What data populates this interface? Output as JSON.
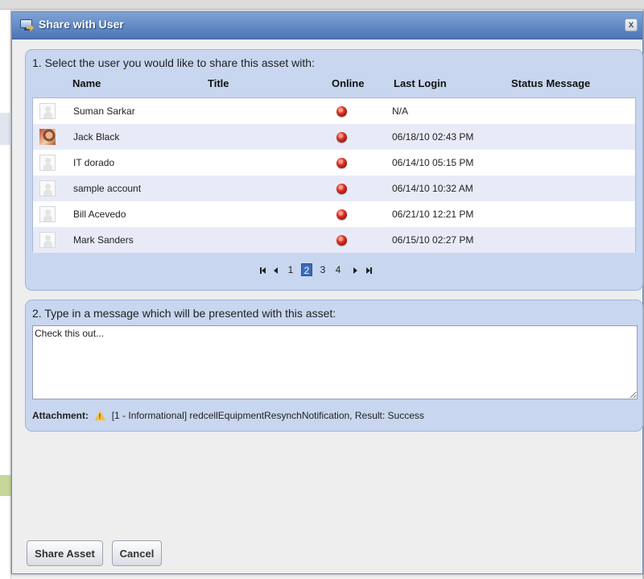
{
  "dialog": {
    "title": "Share with User",
    "close_label": "x"
  },
  "step1": {
    "title": "1. Select the user you would like to share this asset with:",
    "columns": {
      "name": "Name",
      "title": "Title",
      "online": "Online",
      "last_login": "Last Login",
      "status_message": "Status Message"
    },
    "rows": [
      {
        "name": "Suman Sarkar",
        "title": "",
        "online": "offline",
        "last_login": "N/A",
        "status_message": "",
        "avatar": "default"
      },
      {
        "name": "Jack Black",
        "title": "",
        "online": "offline",
        "last_login": "06/18/10 02:43 PM",
        "status_message": "",
        "avatar": "photo"
      },
      {
        "name": "IT dorado",
        "title": "",
        "online": "offline",
        "last_login": "06/14/10 05:15 PM",
        "status_message": "",
        "avatar": "default"
      },
      {
        "name": "sample account",
        "title": "",
        "online": "offline",
        "last_login": "06/14/10 10:32 AM",
        "status_message": "",
        "avatar": "default"
      },
      {
        "name": "Bill Acevedo",
        "title": "",
        "online": "offline",
        "last_login": "06/21/10 12:21 PM",
        "status_message": "",
        "avatar": "default"
      },
      {
        "name": "Mark Sanders",
        "title": "",
        "online": "offline",
        "last_login": "06/15/10 02:27 PM",
        "status_message": "",
        "avatar": "default"
      }
    ],
    "pager": {
      "pages": [
        "1",
        "2",
        "3",
        "4"
      ],
      "current": "2"
    }
  },
  "step2": {
    "title": "2. Type in a message which will be presented with this asset:",
    "message": "Check this out...",
    "attachment_label": "Attachment:",
    "attachment_text": "[1 - Informational] redcellEquipmentResynchNotification, Result: Success"
  },
  "buttons": {
    "share": "Share Asset",
    "cancel": "Cancel"
  },
  "colors": {
    "titlebar": "#4c75b3",
    "panel": "#c9d6ef",
    "offline_dot": "#e2372a",
    "current_page": "#3b6cb8"
  }
}
